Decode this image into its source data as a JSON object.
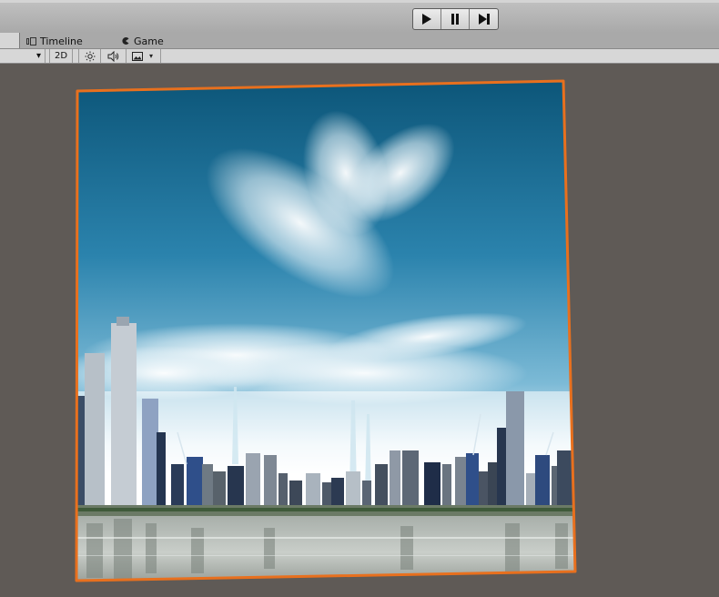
{
  "toolbar": {
    "play_icon": "play-icon",
    "pause_icon": "pause-icon",
    "step_icon": "step-icon"
  },
  "tabs": [
    {
      "label": "Timeline",
      "icon": "timeline-icon"
    },
    {
      "label": "Game",
      "icon": "game-icon"
    }
  ],
  "view_bar": {
    "dropdown_arrow": "▾",
    "mode_2d": "2D",
    "lighting_icon": "sun-icon",
    "audio_icon": "speaker-icon",
    "image_icon": "image-icon"
  },
  "colors": {
    "background": "#5f5a56",
    "selection_outline": "#e8701e",
    "sky_top": "#0d5a7e",
    "sky_mid": "#3d90b8"
  }
}
